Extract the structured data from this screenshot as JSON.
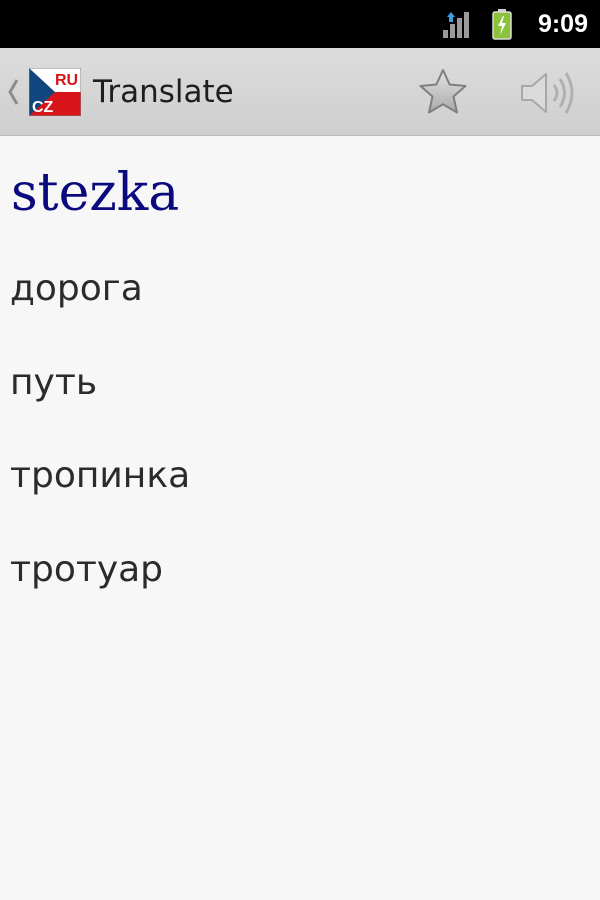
{
  "status_bar": {
    "time": "9:09",
    "icons": [
      "signal-icon",
      "battery-icon"
    ]
  },
  "action_bar": {
    "title": "Translate",
    "logo": {
      "top_label": "RU",
      "bottom_label": "CZ"
    },
    "icons": [
      "back-chevron-icon",
      "star-icon",
      "speaker-icon"
    ]
  },
  "entry": {
    "headword": "stezka",
    "translations": [
      "дорога",
      "путь",
      "тропинка",
      "тротуар"
    ]
  },
  "colors": {
    "headword": "#0a0a7e",
    "translation": "#2b2b2b",
    "background": "#f7f7f7",
    "action_bar": "#d6d6d6",
    "battery": "#8ac33b"
  }
}
